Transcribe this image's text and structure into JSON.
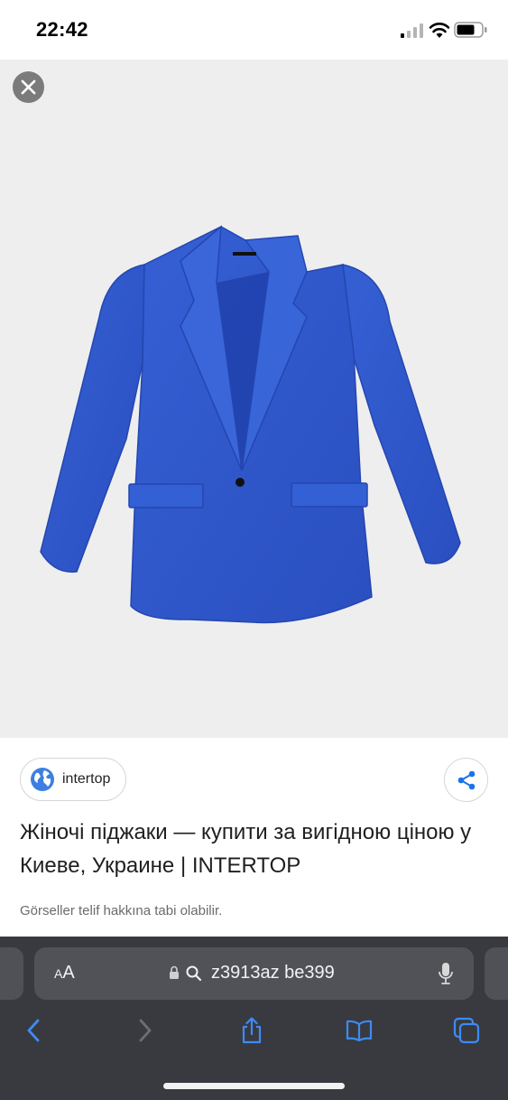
{
  "status_bar": {
    "time": "22:42",
    "icons": [
      "signal-icon",
      "wifi-icon",
      "battery-icon"
    ]
  },
  "viewer": {
    "close_icon": "close-icon",
    "image_alt": "blue-jacket-product-image",
    "colors": {
      "background": "#eeeeee",
      "jacket": "#2d55c8"
    }
  },
  "result": {
    "source_name": "intertop",
    "source_icon": "globe-icon",
    "share_icon": "share-icon",
    "title": "Жіночі піджаки — купити за вигідною ціною у Киеве, Украине | INTERTOP",
    "copyright_note": "Görseller telif hakkına tabi olabilir."
  },
  "browser": {
    "aa_small": "A",
    "aa_large": "A",
    "address": "z3913az be399",
    "icons": [
      "lock-icon",
      "search-icon",
      "mic-icon"
    ],
    "toolbar": [
      "back-icon",
      "forward-icon",
      "share-icon",
      "bookmarks-icon",
      "tabs-icon"
    ],
    "accent": "#3d8bf7"
  }
}
